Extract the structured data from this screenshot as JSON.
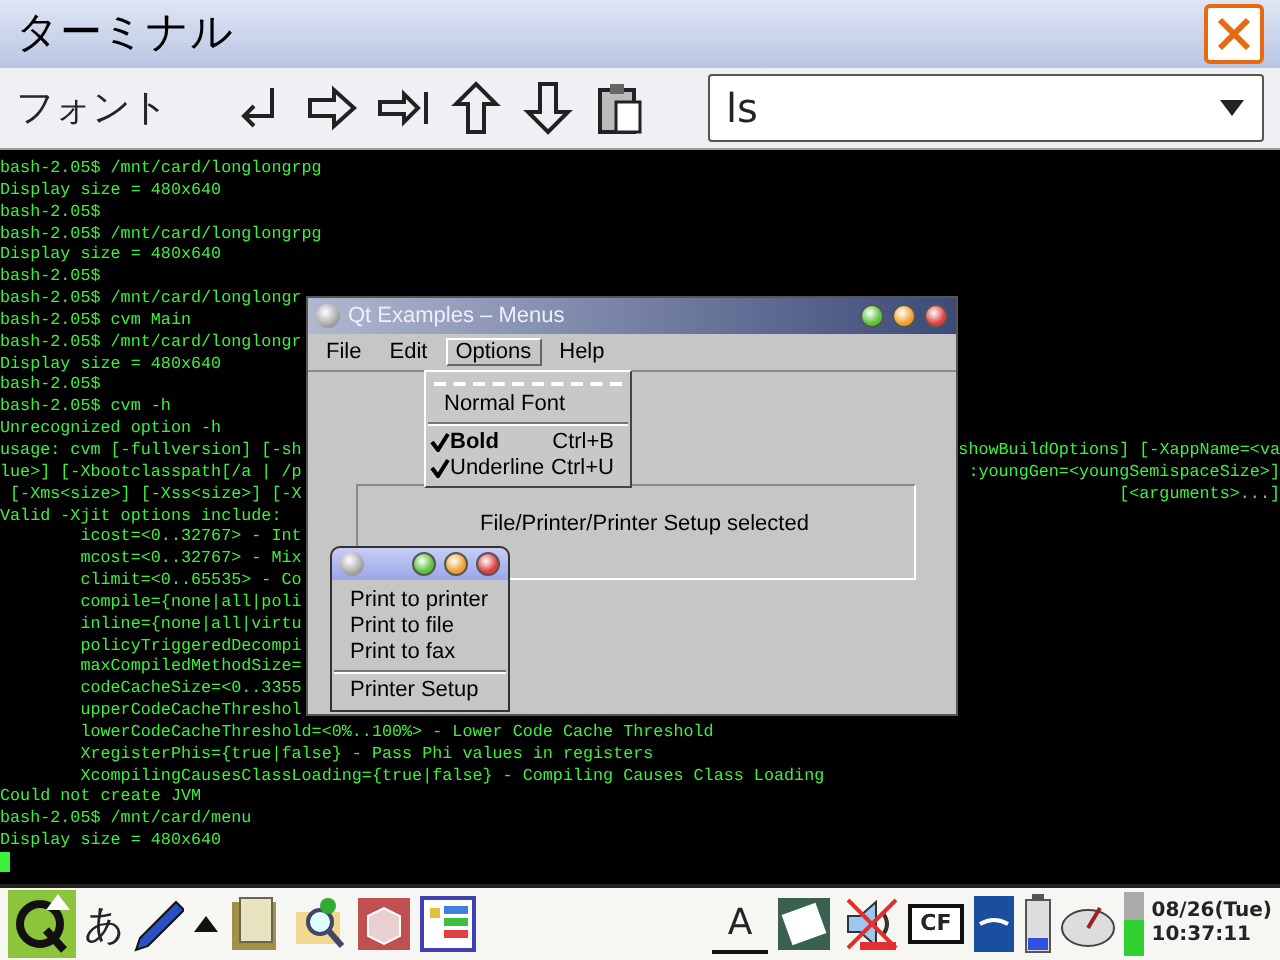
{
  "window": {
    "title": "ターミナル"
  },
  "toolbar": {
    "font_label": "フォント",
    "command": {
      "value": "ls"
    }
  },
  "terminal": {
    "lines": [
      {
        "text": "bash-2.05$ /mnt/card/longlongrpg"
      },
      {
        "text": "Display size = 480x640"
      },
      {
        "text": "bash-2.05$"
      },
      {
        "text": "bash-2.05$ /mnt/card/longlongrpg"
      },
      {
        "text": "Display size = 480x640"
      },
      {
        "text": "bash-2.05$"
      },
      {
        "text": "bash-2.05$ /mnt/card/longlongr"
      },
      {
        "text": "bash-2.05$ cvm Main"
      },
      {
        "text": "bash-2.05$ /mnt/card/longlongr"
      },
      {
        "text": "Display size = 480x640"
      },
      {
        "text": "bash-2.05$"
      },
      {
        "text": "bash-2.05$ cvm -h"
      },
      {
        "text": "Unrecognized option -h"
      },
      {
        "text": "usage: cvm [-fullversion] [-sh",
        "right": "showBuildOptions] [-XappName=<va"
      },
      {
        "text": "lue>] [-Xbootclasspath[/a | /p",
        "right": ":youngGen=<youngSemispaceSize>]"
      },
      {
        "text": " [-Xms<size>] [-Xss<size>] [-X",
        "right": "[<arguments>...]"
      },
      {
        "text": "Valid -Xjit options include:"
      },
      {
        "text": "        icost=<0..32767> - Int"
      },
      {
        "text": "        mcost=<0..32767> - Mix"
      },
      {
        "text": "        climit=<0..65535> - Co"
      },
      {
        "text": "        compile={none|all|poli"
      },
      {
        "text": "        inline={none|all|virtu"
      },
      {
        "text": "        policyTriggeredDecompi"
      },
      {
        "text": "        maxCompiledMethodSize="
      },
      {
        "text": "        codeCacheSize=<0..3355"
      },
      {
        "text": "        upperCodeCacheThreshol"
      },
      {
        "text": "        lowerCodeCacheThreshold=<0%..100%> - Lower Code Cache Threshold"
      },
      {
        "text": "        XregisterPhis={true|false} - Pass Phi values in registers"
      },
      {
        "text": "        XcompilingCausesClassLoading={true|false} - Compiling Causes Class Loading"
      },
      {
        "text": "Could not create JVM"
      },
      {
        "text": "bash-2.05$ /mnt/card/menu"
      },
      {
        "text": "Display size = 480x640"
      }
    ]
  },
  "qt_window": {
    "title": "Qt Examples – Menus",
    "menus": [
      {
        "label": "File",
        "selected": false
      },
      {
        "label": "Edit",
        "selected": false
      },
      {
        "label": "Options",
        "selected": true
      },
      {
        "label": "Help",
        "selected": false
      }
    ],
    "options_menu": [
      {
        "kind": "tearoff"
      },
      {
        "kind": "item",
        "label": "Normal Font"
      },
      {
        "kind": "separator"
      },
      {
        "kind": "check",
        "label": "Bold",
        "bold": true,
        "shortcut": "Ctrl+B",
        "checked": true
      },
      {
        "kind": "check",
        "label": "Underline",
        "bold": false,
        "shortcut": "Ctrl+U",
        "checked": true
      }
    ],
    "status": "File/Printer/Printer Setup selected"
  },
  "popup": {
    "items": [
      {
        "kind": "item",
        "label": "Print to printer"
      },
      {
        "kind": "item",
        "label": "Print to file"
      },
      {
        "kind": "item",
        "label": "Print to fax"
      },
      {
        "kind": "separator"
      },
      {
        "kind": "item",
        "label": "Printer Setup"
      }
    ]
  },
  "taskbar": {
    "input_char": "あ",
    "ime_label": "A",
    "sound_muted": true,
    "cf_label": "CF",
    "date": "08/26(Tue)",
    "time": "10:37:11"
  }
}
